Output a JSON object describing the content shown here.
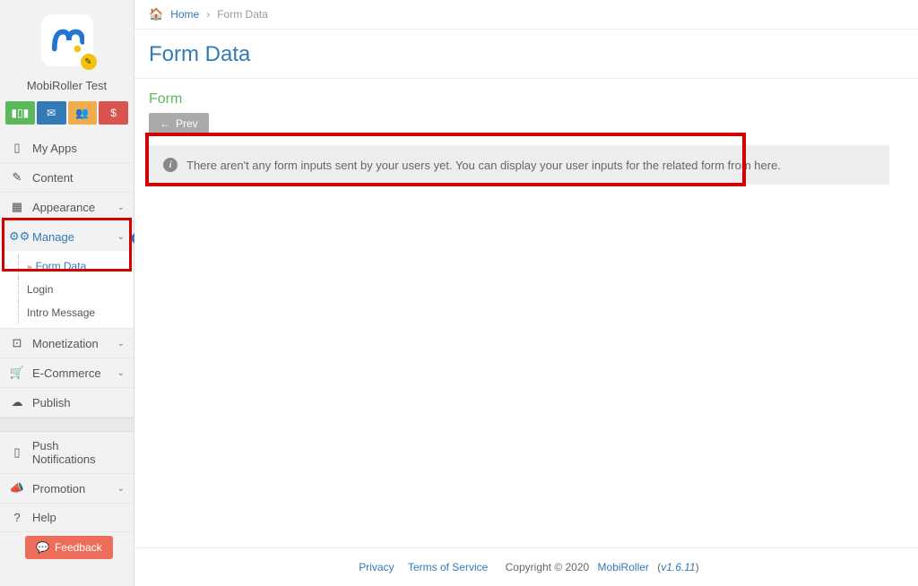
{
  "app": {
    "name": "MobiRoller Test"
  },
  "toolbarIcons": [
    "stats",
    "mail",
    "users",
    "dollar"
  ],
  "nav": {
    "myapps": "My Apps",
    "content": "Content",
    "appearance": "Appearance",
    "manage": "Manage",
    "manage_sub": {
      "formdata": "Form Data",
      "login": "Login",
      "intro": "Intro Message"
    },
    "monetization": "Monetization",
    "ecommerce": "E-Commerce",
    "publish": "Publish",
    "push": "Push Notifications",
    "promotion": "Promotion",
    "help": "Help"
  },
  "crumbs": {
    "home": "Home",
    "current": "Form Data"
  },
  "page": {
    "title": "Form Data",
    "section": "Form",
    "prev": "Prev"
  },
  "info": {
    "msg": "There aren't any form inputs sent by your users yet. You can display your user inputs for the related form from here."
  },
  "feedback": "Feedback",
  "footer": {
    "privacy": "Privacy",
    "tos": "Terms of Service",
    "copy": "Copyright © 2020 ",
    "brand": "MobiRoller",
    "ver": "v1.6.11"
  }
}
